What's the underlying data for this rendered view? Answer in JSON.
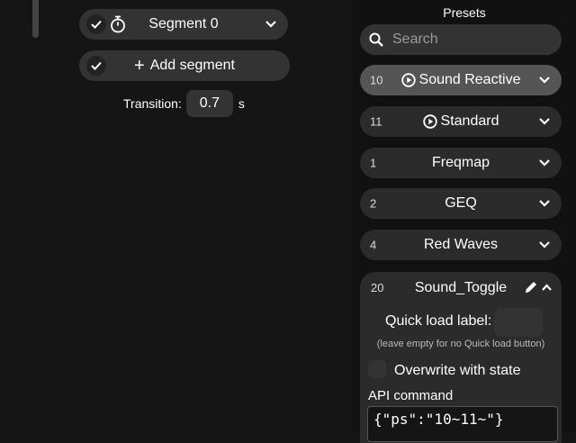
{
  "segments": {
    "segment": {
      "name": "Segment 0"
    },
    "add_segment_label": "Add segment",
    "transition": {
      "label": "Transition:",
      "value": "0.7",
      "unit": "s"
    }
  },
  "presets": {
    "title": "Presets",
    "search_placeholder": "Search",
    "items": [
      {
        "id": "10",
        "name": "Sound Reactive",
        "selected": true,
        "playlist": true
      },
      {
        "id": "11",
        "name": "Standard",
        "selected": false,
        "playlist": true
      },
      {
        "id": "1",
        "name": "Freqmap",
        "selected": false,
        "playlist": false
      },
      {
        "id": "2",
        "name": "GEQ",
        "selected": false,
        "playlist": false
      },
      {
        "id": "4",
        "name": "Red Waves",
        "selected": false,
        "playlist": false
      }
    ],
    "expanded": {
      "id": "20",
      "name": "Sound_Toggle",
      "quick_load_label": "Quick load label:",
      "quick_load_value": "",
      "quick_load_hint": "(leave empty for no Quick load button)",
      "overwrite_label": "Overwrite with state",
      "overwrite_checked": false,
      "api_label": "API command",
      "api_value": "{\"ps\":\"10~11~\"}"
    }
  },
  "colors": {
    "background": "#151515",
    "pill": "#333333",
    "selected": "#555555"
  }
}
